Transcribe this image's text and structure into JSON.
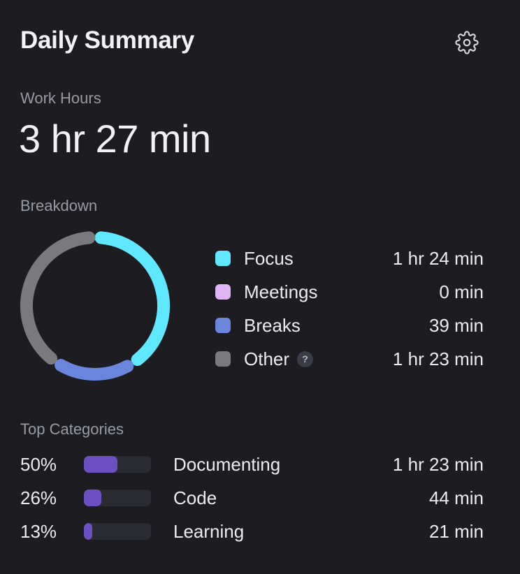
{
  "header": {
    "title": "Daily Summary",
    "settings_icon": "gear-icon"
  },
  "work_hours": {
    "label": "Work Hours",
    "value": "3 hr 27 min"
  },
  "breakdown": {
    "label": "Breakdown",
    "items": [
      {
        "name": "Focus",
        "value": "1 hr 24 min",
        "minutes": 84,
        "color": "#5fe8ff"
      },
      {
        "name": "Meetings",
        "value": "0 min",
        "minutes": 0,
        "color": "#e2b4f4"
      },
      {
        "name": "Breaks",
        "value": "39 min",
        "minutes": 39,
        "color": "#6a86dc"
      },
      {
        "name": "Other",
        "value": "1 hr 23 min",
        "minutes": 83,
        "color": "#7a7a7e",
        "help": "?"
      }
    ]
  },
  "top_categories": {
    "label": "Top Categories",
    "bar_color": "#6c4fc0",
    "track_color": "#2b2b33",
    "items": [
      {
        "percent": "50%",
        "fraction": 0.5,
        "name": "Documenting",
        "value": "1 hr 23 min"
      },
      {
        "percent": "26%",
        "fraction": 0.26,
        "name": "Code",
        "value": "44 min"
      },
      {
        "percent": "13%",
        "fraction": 0.13,
        "name": "Learning",
        "value": "21 min"
      }
    ]
  }
}
